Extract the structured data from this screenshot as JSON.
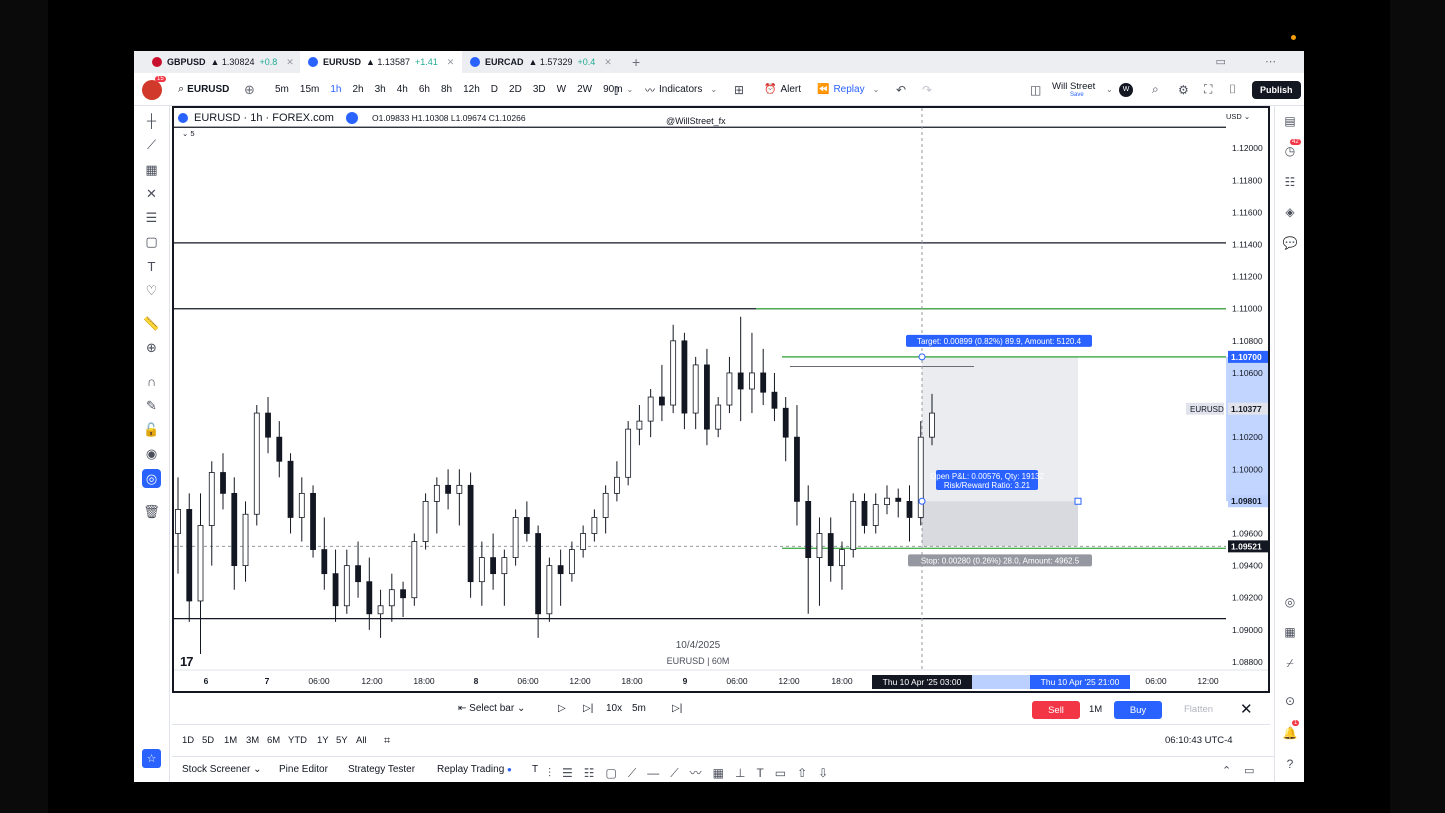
{
  "tabs": [
    {
      "symbol": "GBPUSD",
      "price": "▲ 1.30824",
      "change": "+0.8",
      "active": false
    },
    {
      "symbol": "EURUSD",
      "price": "▲ 1.13587",
      "change": "+1.41",
      "active": true
    },
    {
      "symbol": "EURCAD",
      "price": "▲ 1.57329",
      "change": "+0.4",
      "active": false
    }
  ],
  "toolbar": {
    "avatar_badge": "15",
    "symbol": "EURUSD",
    "timeframes": [
      "5m",
      "15m",
      "1h",
      "2h",
      "3h",
      "4h",
      "6h",
      "8h",
      "12h",
      "D",
      "2D",
      "3D",
      "W",
      "2W",
      "90m"
    ],
    "active_timeframe": "1h",
    "indicators_label": "Indicators",
    "alert_label": "Alert",
    "replay_label": "Replay",
    "layout_name": "Will Street",
    "layout_sub": "Save",
    "publish_label": "Publish"
  },
  "chart": {
    "title": "EURUSD · 1h · FOREX.com",
    "ohlc": "O1.09833 H1.10308 L1.09674 C1.10266",
    "indicator_count": "5",
    "watermark_handle": "@WillStreet_fx",
    "currency": "USD",
    "replay_date": "10/4/2025",
    "replay_symbol": "EURUSD | 60M",
    "price_labels": [
      "1.12000",
      "1.11800",
      "1.11600",
      "1.11400",
      "1.11200",
      "1.11000",
      "1.10800",
      "1.10600",
      "1.10200",
      "1.10000",
      "1.09600",
      "1.09400",
      "1.09200",
      "1.09000",
      "1.08800"
    ],
    "time_labels": [
      "6",
      "7",
      "06:00",
      "12:00",
      "18:00",
      "8",
      "06:00",
      "12:00",
      "18:00",
      "9",
      "06:00",
      "12:00",
      "18:00",
      "12:00",
      "06:00",
      "12:00"
    ],
    "cursor_time": "Thu 10 Apr '25  03:00",
    "range_end_time": "Thu 10 Apr '25  21:00",
    "target_label": "Target: 0.00899 (0.82%) 89.9, Amount: 5120.4",
    "target_price": "1.10700",
    "symbol_tag": "EURUSD",
    "symbol_price": "1.10377",
    "entry_price": "1.09801",
    "current_price": "1.09521",
    "pnl_line1": "Open P&L: 0.00576, Qty: 19132",
    "pnl_line2": "Risk/Reward Ratio: 3.21",
    "stop_label": "Stop: 0.00280 (0.26%) 28.0, Amount: 4962.5",
    "colors": {
      "up": "#ffffff",
      "down": "#131722",
      "target": "#4caf50",
      "accent": "#2962ff"
    }
  },
  "chart_data": {
    "type": "candlestick",
    "title": "EURUSD · 1h · FOREX.com",
    "y_range": [
      1.0875,
      1.1225
    ],
    "horizontal_levels": [
      1.1213,
      1.1141,
      1.11,
      1.0907
    ],
    "position": {
      "target": 1.107,
      "entry": 1.09801,
      "stop": 1.0952
    },
    "candles": [
      [
        1.096,
        1.0995,
        1.0935,
        1.0975
      ],
      [
        1.0975,
        1.0985,
        1.0905,
        1.0918
      ],
      [
        1.0918,
        1.0985,
        1.0885,
        1.0965
      ],
      [
        1.0965,
        1.1005,
        1.094,
        1.0998
      ],
      [
        1.0998,
        1.101,
        1.0975,
        1.0985
      ],
      [
        1.0985,
        1.0995,
        1.0925,
        1.094
      ],
      [
        1.094,
        1.098,
        1.093,
        1.0972
      ],
      [
        1.0972,
        1.104,
        1.0965,
        1.1035
      ],
      [
        1.1035,
        1.1045,
        1.101,
        1.102
      ],
      [
        1.102,
        1.103,
        1.0995,
        1.1005
      ],
      [
        1.1005,
        1.101,
        1.096,
        1.097
      ],
      [
        1.097,
        1.0995,
        1.0955,
        1.0985
      ],
      [
        1.0985,
        1.099,
        1.0945,
        1.095
      ],
      [
        1.095,
        1.097,
        1.0925,
        1.0935
      ],
      [
        1.0935,
        1.095,
        1.0905,
        1.0915
      ],
      [
        1.0915,
        1.095,
        1.091,
        1.094
      ],
      [
        1.094,
        1.0955,
        1.092,
        1.093
      ],
      [
        1.093,
        1.0945,
        1.09,
        1.091
      ],
      [
        1.091,
        1.0925,
        1.0895,
        1.0915
      ],
      [
        1.0915,
        1.0935,
        1.0905,
        1.0925
      ],
      [
        1.0925,
        1.093,
        1.0908,
        1.092
      ],
      [
        1.092,
        1.096,
        1.0915,
        1.0955
      ],
      [
        1.0955,
        1.0985,
        1.095,
        1.098
      ],
      [
        1.098,
        1.0995,
        1.096,
        1.099
      ],
      [
        1.099,
        1.1,
        1.0975,
        1.0985
      ],
      [
        1.0985,
        1.1,
        1.0965,
        1.099
      ],
      [
        1.099,
        1.0998,
        1.092,
        1.093
      ],
      [
        1.093,
        1.0955,
        1.0915,
        1.0945
      ],
      [
        1.0945,
        1.096,
        1.0925,
        1.0935
      ],
      [
        1.0935,
        1.095,
        1.0915,
        1.0945
      ],
      [
        1.0945,
        1.0975,
        1.094,
        1.097
      ],
      [
        1.097,
        1.098,
        1.0955,
        1.096
      ],
      [
        1.096,
        1.0965,
        1.0895,
        1.091
      ],
      [
        1.091,
        1.0945,
        1.0905,
        1.094
      ],
      [
        1.094,
        1.095,
        1.0915,
        1.0935
      ],
      [
        1.0935,
        1.0955,
        1.093,
        1.095
      ],
      [
        1.095,
        1.0965,
        1.0945,
        1.096
      ],
      [
        1.096,
        1.0975,
        1.0955,
        1.097
      ],
      [
        1.097,
        1.099,
        1.096,
        1.0985
      ],
      [
        1.0985,
        1.1005,
        1.098,
        1.0995
      ],
      [
        1.0995,
        1.103,
        1.099,
        1.1025
      ],
      [
        1.1025,
        1.104,
        1.1015,
        1.103
      ],
      [
        1.103,
        1.105,
        1.102,
        1.1045
      ],
      [
        1.1045,
        1.1065,
        1.103,
        1.104
      ],
      [
        1.104,
        1.109,
        1.1035,
        1.108
      ],
      [
        1.108,
        1.1085,
        1.1025,
        1.1035
      ],
      [
        1.1035,
        1.107,
        1.1025,
        1.1065
      ],
      [
        1.1065,
        1.1075,
        1.1015,
        1.1025
      ],
      [
        1.1025,
        1.1045,
        1.102,
        1.104
      ],
      [
        1.104,
        1.107,
        1.1035,
        1.106
      ],
      [
        1.106,
        1.1095,
        1.103,
        1.105
      ],
      [
        1.105,
        1.1085,
        1.1035,
        1.106
      ],
      [
        1.106,
        1.1075,
        1.104,
        1.1048
      ],
      [
        1.1048,
        1.106,
        1.103,
        1.1038
      ],
      [
        1.1038,
        1.1045,
        1.1005,
        1.102
      ],
      [
        1.102,
        1.104,
        1.0965,
        1.098
      ],
      [
        1.098,
        1.099,
        1.091,
        1.0945
      ],
      [
        1.0945,
        1.097,
        1.0915,
        1.096
      ],
      [
        1.096,
        1.097,
        1.093,
        1.094
      ],
      [
        1.094,
        1.0955,
        1.0925,
        1.095
      ],
      [
        1.095,
        1.0985,
        1.0945,
        1.098
      ],
      [
        1.098,
        1.0985,
        1.096,
        1.0965
      ],
      [
        1.0965,
        1.0985,
        1.096,
        1.0978
      ],
      [
        1.0978,
        1.099,
        1.0972,
        1.0982
      ],
      [
        1.0982,
        1.0988,
        1.097,
        1.098
      ],
      [
        1.098,
        1.099,
        1.0955,
        1.097
      ],
      [
        1.097,
        1.103,
        1.0965,
        1.102
      ],
      [
        1.102,
        1.1047,
        1.1015,
        1.1035
      ]
    ]
  },
  "replaybar": {
    "select_bar": "Select bar",
    "speed": "10x",
    "interval": "5m",
    "sell": "Sell",
    "qty": "1M",
    "buy": "Buy",
    "flatten": "Flatten"
  },
  "ranges": [
    "1D",
    "5D",
    "1M",
    "3M",
    "6M",
    "YTD",
    "1Y",
    "5Y",
    "All"
  ],
  "clock": "06:10:43 UTC-4",
  "bottom_tabs": [
    "Stock Screener",
    "Pine Editor",
    "Strategy Tester",
    "Replay Trading",
    "T"
  ],
  "rightbar": {
    "badge_alerts": "42",
    "badge_notify": "1"
  }
}
